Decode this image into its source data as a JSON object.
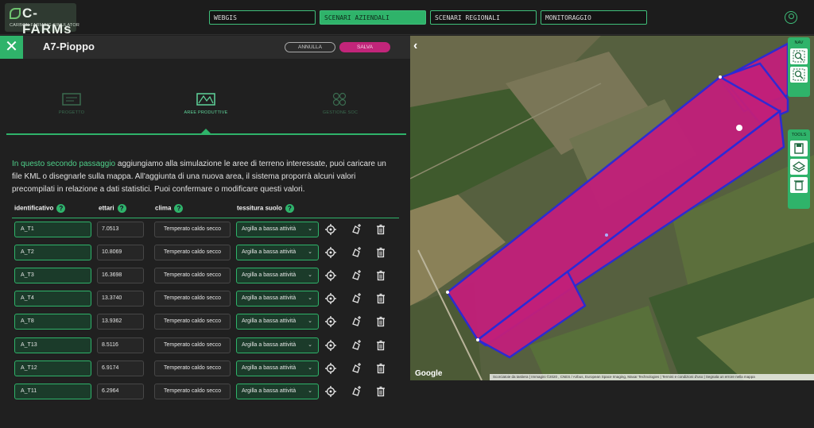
{
  "logo": {
    "brand": "C-FARMs",
    "tagline": "CARBON FARMING SIMULATOR"
  },
  "nav": [
    {
      "label": "WEBGIS",
      "active": false
    },
    {
      "label": "SCENARI AZIENDALI",
      "active": true
    },
    {
      "label": "SCENARI REGIONALI",
      "active": false
    },
    {
      "label": "MONITORAGGIO",
      "active": false
    }
  ],
  "panel": {
    "title": "A7-Pioppo",
    "cancel_label": "ANNULLA",
    "save_label": "SALVA",
    "close_glyph": "✕"
  },
  "steps": [
    {
      "label": "PROGETTO",
      "active": false
    },
    {
      "label": "AREE PRODUTTIVE",
      "active": true
    },
    {
      "label": "GESTIONE SOC",
      "active": false
    }
  ],
  "intro": {
    "highlight": "In questo secondo passaggio",
    "text": " aggiungiamo alla simulazione le aree di terreno interessate, puoi caricare un file KML o disegnarle sulla mappa. All'aggiunta di una nuova area, il sistema proporrà alcuni valori precompilati in relazione a dati statistici. Puoi confermare o modificare questi valori."
  },
  "table": {
    "headers": {
      "id": "identificativo",
      "ha": "ettari",
      "clima": "clima",
      "tex": "tessitura suolo"
    },
    "help_glyph": "?",
    "rows": [
      {
        "id": "A_T1",
        "ha": "7.0513",
        "clima": "Temperato caldo secco",
        "tex": "Argilla a bassa attività"
      },
      {
        "id": "A_T2",
        "ha": "10.8069",
        "clima": "Temperato caldo secco",
        "tex": "Argilla a bassa attività"
      },
      {
        "id": "A_T3",
        "ha": "16.3698",
        "clima": "Temperato caldo secco",
        "tex": "Argilla a bassa attività"
      },
      {
        "id": "A_T4",
        "ha": "13.3740",
        "clima": "Temperato caldo secco",
        "tex": "Argilla a bassa attività"
      },
      {
        "id": "A_T8",
        "ha": "13.9362",
        "clima": "Temperato caldo secco",
        "tex": "Argilla a bassa attività"
      },
      {
        "id": "A_T13",
        "ha": "8.5116",
        "clima": "Temperato caldo secco",
        "tex": "Argilla a bassa attività"
      },
      {
        "id": "A_T12",
        "ha": "6.9174",
        "clima": "Temperato caldo secco",
        "tex": "Argilla a bassa attività"
      },
      {
        "id": "A_T11",
        "ha": "6.2964",
        "clima": "Temperato caldo secco",
        "tex": "Argilla a bassa attività"
      }
    ]
  },
  "map": {
    "back_glyph": "‹",
    "nav_title": "NAV",
    "tools_title": "TOOLS",
    "google_label": "Google",
    "attribution": "Scorciatoie da tastiera | Immagini ©2020 , CNES / Airbus, European Space Imaging, Maxar Technologies | Termini e condizioni d'uso | Segnala un errore nella mappa",
    "polygon_fill": "#c21f7a",
    "polygon_stroke": "#2a2ad8"
  },
  "colors": {
    "accent": "#2fb36a",
    "save": "#c2257a"
  }
}
